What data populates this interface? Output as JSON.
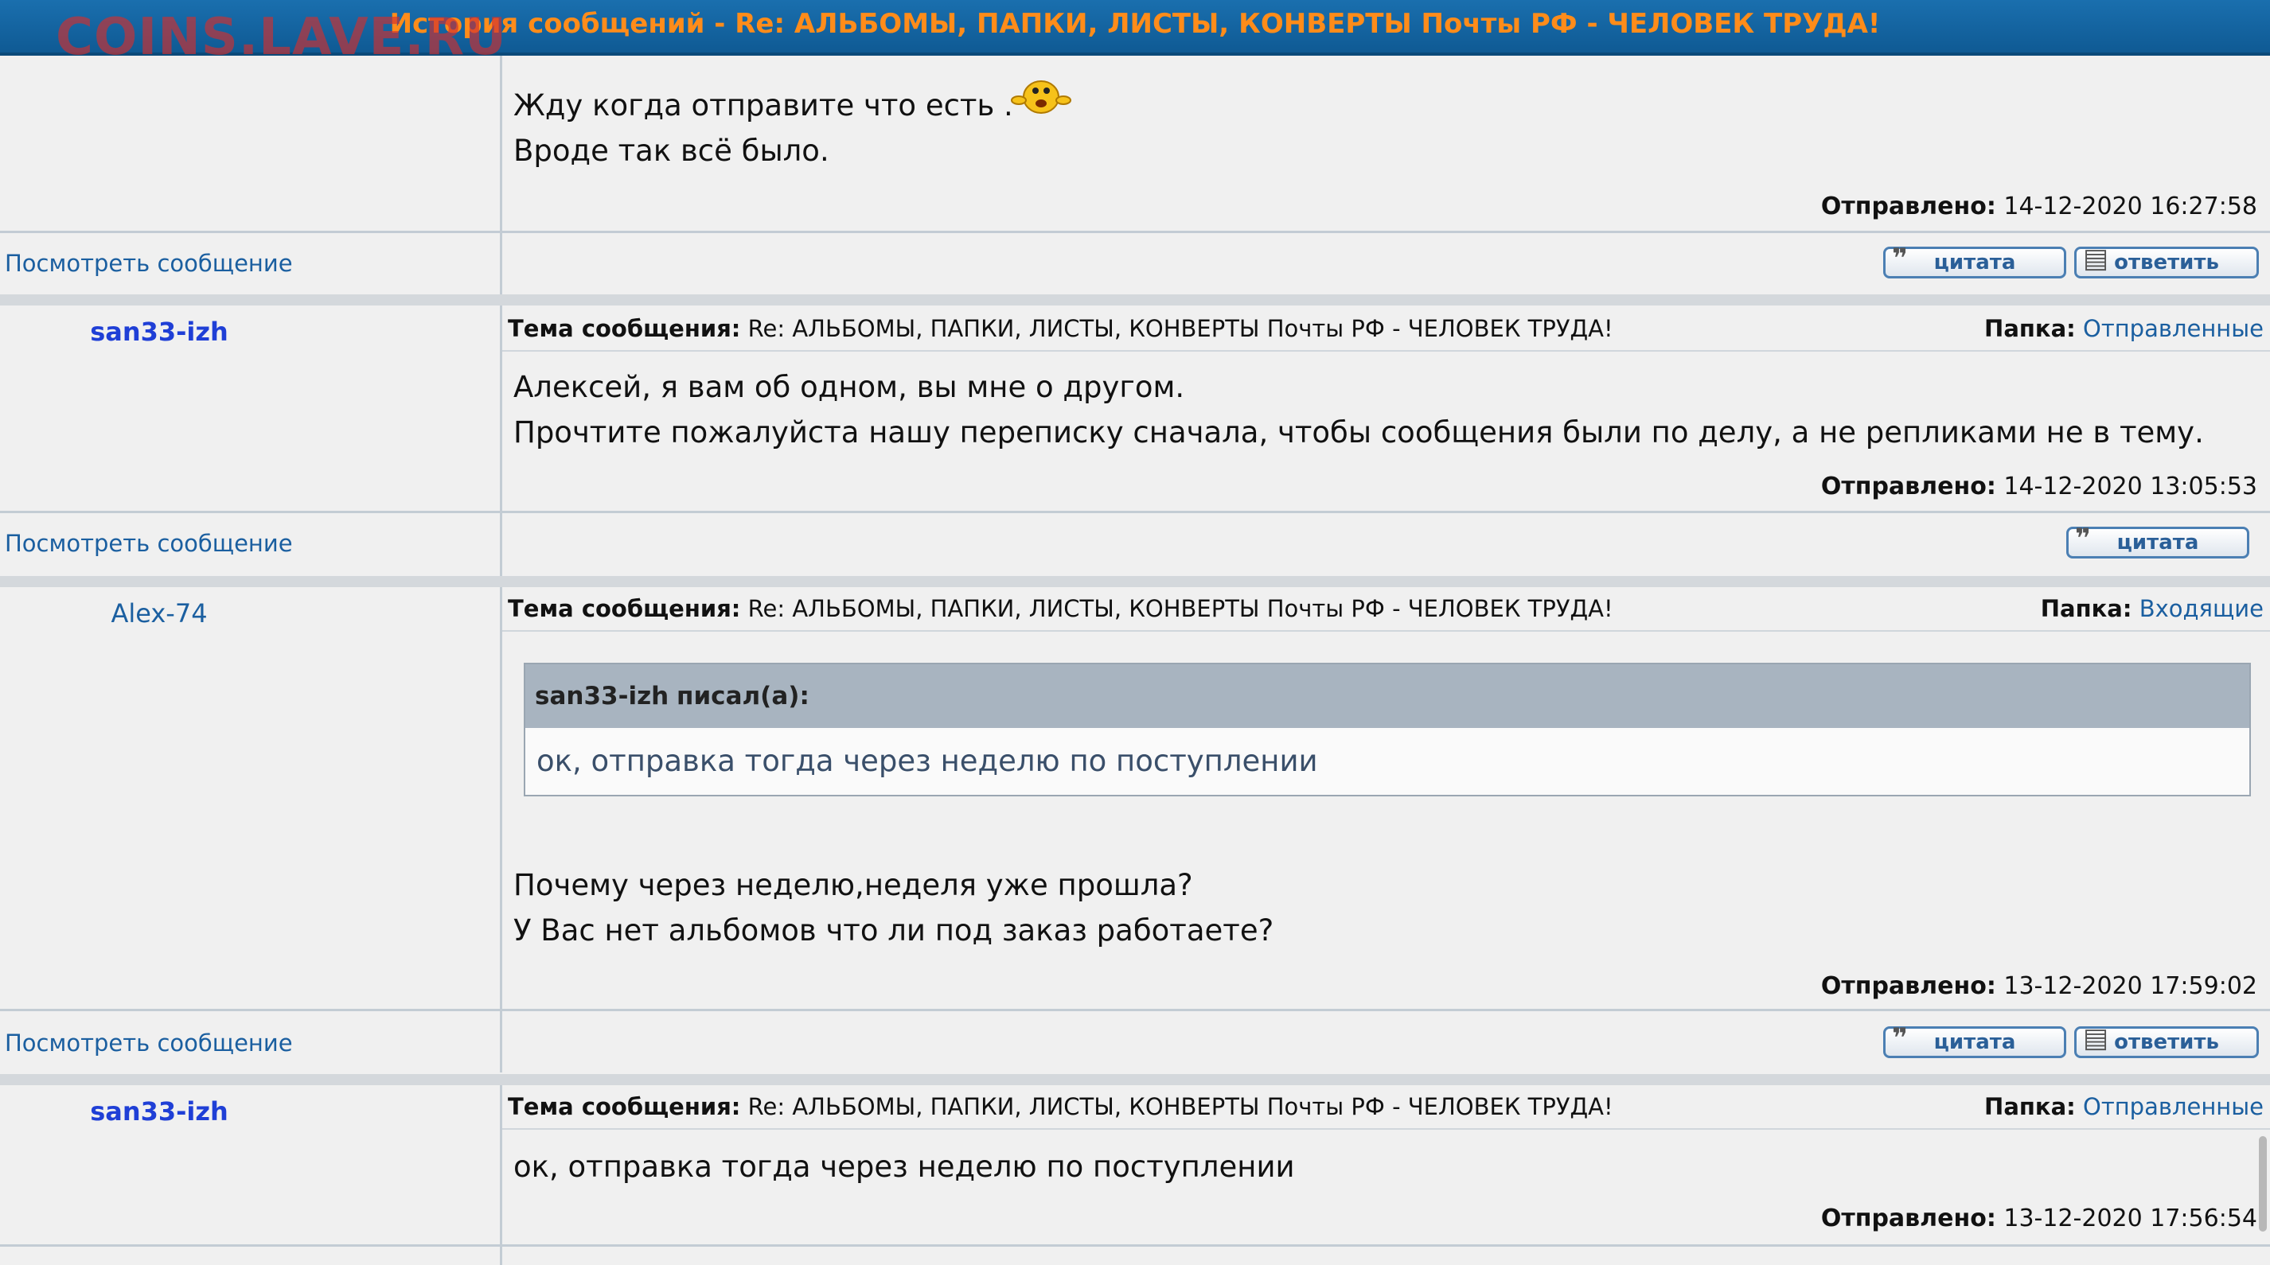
{
  "window": {
    "title": "История сообщений - Re: АЛЬБОМЫ, ПАПКИ, ЛИСТЫ, КОНВЕРТЫ Почты РФ - ЧЕЛОВЕК ТРУДА!",
    "watermark": "COINS.LAVE.RU"
  },
  "labels": {
    "subject_label": "Тема сообщения:",
    "folder_label": "Папка:",
    "sent_label": "Отправлено:",
    "view_message": "Посмотреть сообщение",
    "quote_button": "цитата",
    "reply_button": "ответить",
    "wrote_suffix": "писал(а):"
  },
  "messages": [
    {
      "lines": [
        "Жду когда отправите что есть .",
        "Вроде так всё было."
      ],
      "has_smiley": true,
      "sent": "14-12-2020 16:27:58"
    },
    {
      "author": "san33-izh",
      "subject": "Re: АЛЬБОМЫ, ПАПКИ, ЛИСТЫ, КОНВЕРТЫ Почты РФ - ЧЕЛОВЕК ТРУДА!",
      "folder": "Отправленные",
      "lines": [
        "Алексей, я вам об одном, вы мне о другом.",
        "Прочтите пожалуйста нашу переписку сначала, чтобы сообщения были по делу, а не репликами не в тему."
      ],
      "sent": "14-12-2020 13:05:53"
    },
    {
      "author": "Alex-74",
      "subject": "Re: АЛЬБОМЫ, ПАПКИ, ЛИСТЫ, КОНВЕРТЫ Почты РФ - ЧЕЛОВЕК ТРУДА!",
      "folder": "Входящие",
      "quote": {
        "author": "san33-izh",
        "text": "ок, отправка тогда через неделю по поступлении"
      },
      "lines": [
        "Почему через неделю,неделя уже прошла?",
        "У Вас нет альбомов что ли под заказ работаете?"
      ],
      "sent": "13-12-2020 17:59:02"
    },
    {
      "author": "san33-izh",
      "subject": "Re: АЛЬБОМЫ, ПАПКИ, ЛИСТЫ, КОНВЕРТЫ Почты РФ - ЧЕЛОВЕК ТРУДА!",
      "folder": "Отправленные",
      "lines": [
        "ок, отправка тогда через неделю по поступлении"
      ],
      "sent": "13-12-2020 17:56:54"
    }
  ],
  "icons": {
    "quote": "speech-bubble-icon",
    "reply": "document-icon",
    "smiley": "smiley-emoticon"
  },
  "colors": {
    "title_bar": "#1a6fae",
    "title_text": "#ff8c1a",
    "author_link": "#1f3fd6",
    "link": "#1b5fa0"
  }
}
